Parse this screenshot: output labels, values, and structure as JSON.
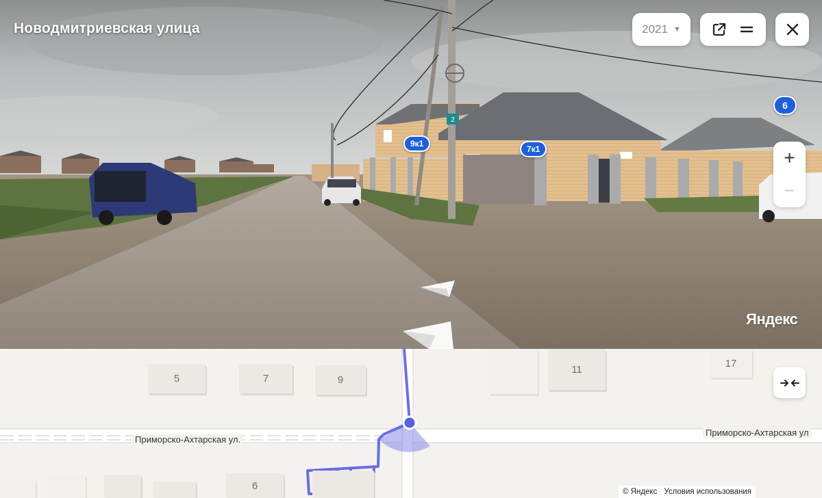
{
  "panorama": {
    "street_title": "Новодмитриевская улица",
    "year": "2021",
    "year_caret": "▼",
    "watermark": "Яндекс",
    "zoom_in": "+",
    "zoom_out": "−",
    "badges": {
      "house_6": "6",
      "house_9k1": "9к1",
      "house_7k1": "7к1",
      "pole_sign": "2"
    },
    "icons": {
      "open_external": "external-link-icon",
      "menu": "menu-icon",
      "close": "close-icon",
      "forward": "forward-arrow-icon",
      "backward": "backward-arrow-icon"
    },
    "colors": {
      "badge": "#1d5fde",
      "sky": "#b9bcbd",
      "road": "#9f9489"
    }
  },
  "map": {
    "buildings": [
      "5",
      "7",
      "9",
      "11",
      "17",
      "6"
    ],
    "street_left": "Приморско-Ахтарская ул.",
    "street_right": "Приморско-Ахтарская ул",
    "collapse_icon": "collapse-arrows-icon",
    "copyright": "© Яндекс",
    "terms_link": "Условия использования",
    "colors": {
      "route": "#5b5fe8",
      "view_cone": "#6f73e6"
    }
  }
}
